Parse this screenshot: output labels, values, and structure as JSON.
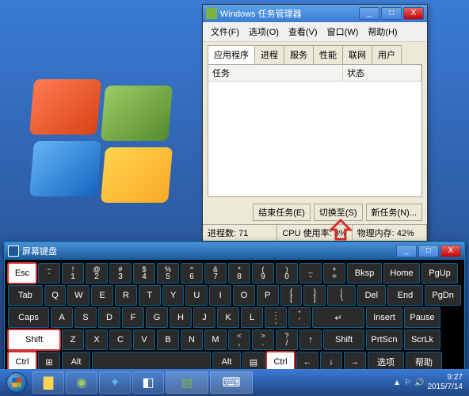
{
  "desktop": {
    "logo_colors": [
      "#d84315",
      "#558b2f",
      "#1565c0",
      "#f9a825"
    ]
  },
  "taskmgr": {
    "title": "Windows 任务管理器",
    "menu": [
      "文件(F)",
      "选项(O)",
      "查看(V)",
      "窗口(W)",
      "帮助(H)"
    ],
    "tabs": [
      "应用程序",
      "进程",
      "服务",
      "性能",
      "联网",
      "用户"
    ],
    "columns": [
      "任务",
      "状态"
    ],
    "buttons": {
      "end": "结束任务(E)",
      "switch": "切换至(S)",
      "new": "新任务(N)..."
    },
    "status": {
      "procs": "进程数: 71",
      "cpu": "CPU 使用率: 3%",
      "mem": "物理内存: 42%"
    }
  },
  "osk": {
    "title": "屏幕键盘",
    "row1": [
      "Esc",
      "~ `",
      "! 1",
      "@ 2",
      "# 3",
      "$ 4",
      "% 5",
      "^ 6",
      "& 7",
      "* 8",
      "( 9",
      ") 0",
      "_ -",
      "+ =",
      "Bksp",
      "Home",
      "PgUp"
    ],
    "row2": [
      "Tab",
      "Q",
      "W",
      "E",
      "R",
      "T",
      "Y",
      "U",
      "I",
      "O",
      "P",
      "{ [",
      "} ]",
      "| \\",
      "Del",
      "End",
      "PgDn"
    ],
    "row3": [
      "Caps",
      "A",
      "S",
      "D",
      "F",
      "G",
      "H",
      "J",
      "K",
      "L",
      ": ;",
      "\" '",
      "↵",
      "Insert",
      "Pause"
    ],
    "row4": [
      "Shift",
      "Z",
      "X",
      "C",
      "V",
      "B",
      "N",
      "M",
      "< ,",
      "> .",
      "? /",
      "↑",
      "Shift",
      "PrtScn",
      "ScrLk"
    ],
    "row5": [
      "Ctrl",
      "⊞",
      "Alt",
      " ",
      "Alt",
      "▤",
      "Ctrl",
      "←",
      "↓",
      "→",
      "选项",
      "帮助"
    ]
  },
  "taskbar": {
    "time": "9:27",
    "date": "2015/7/14",
    "tray_icons": [
      "▲",
      "⚐",
      "🔊"
    ]
  }
}
